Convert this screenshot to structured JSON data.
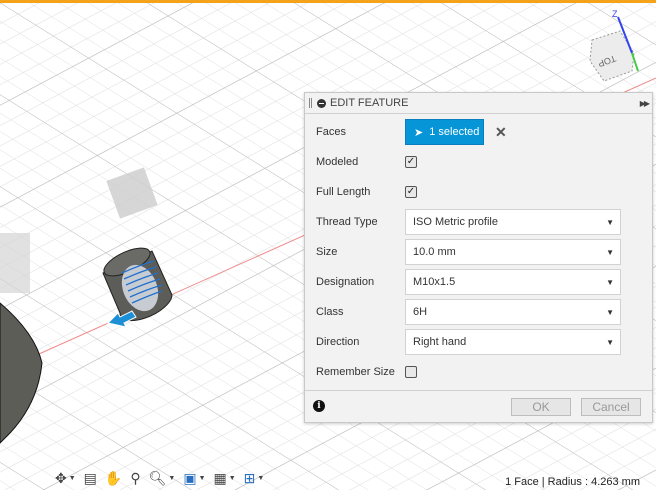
{
  "panel": {
    "title": "EDIT FEATURE",
    "faces_label": "Faces",
    "faces_value": "1 selected",
    "modeled_label": "Modeled",
    "modeled_checked": true,
    "full_length_label": "Full Length",
    "full_length_checked": true,
    "thread_type_label": "Thread Type",
    "thread_type_value": "ISO Metric profile",
    "size_label": "Size",
    "size_value": "10.0 mm",
    "designation_label": "Designation",
    "designation_value": "M10x1.5",
    "class_label": "Class",
    "class_value": "6H",
    "direction_label": "Direction",
    "direction_value": "Right hand",
    "remember_label": "Remember Size",
    "remember_checked": false,
    "ok_label": "OK",
    "cancel_label": "Cancel"
  },
  "viewcube": {
    "face_label": "TOP",
    "axis_z": "Z"
  },
  "status": "1 Face | Radius : 4.263 mm",
  "colors": {
    "accent": "#0696d7",
    "topbar": "#f5a21b"
  }
}
